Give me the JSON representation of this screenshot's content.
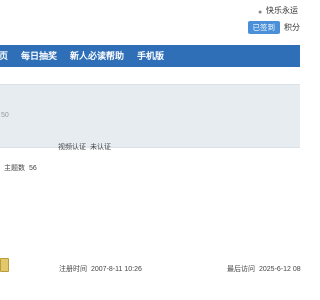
{
  "header": {
    "username": "快乐永运",
    "signed_label": "已签到",
    "points_label": "积分"
  },
  "nav": {
    "items": [
      {
        "label": "页"
      },
      {
        "label": "每日抽奖"
      },
      {
        "label": "新人必读帮助"
      },
      {
        "label": "手机版"
      }
    ]
  },
  "profile": {
    "band_number": "50",
    "video_auth": {
      "label": "视频认证",
      "value": "未认证"
    },
    "topics": {
      "label": "主题数",
      "value": "56"
    },
    "register": {
      "label": "注册时间",
      "value": "2007-8-11 10:26"
    },
    "last_visit": {
      "label": "最后访问",
      "value": "2025-6-12 08"
    }
  },
  "colors": {
    "nav_bg": "#2e6fb8",
    "badge_bg": "#4a8fd8",
    "band_bg": "#e7ecf1"
  }
}
